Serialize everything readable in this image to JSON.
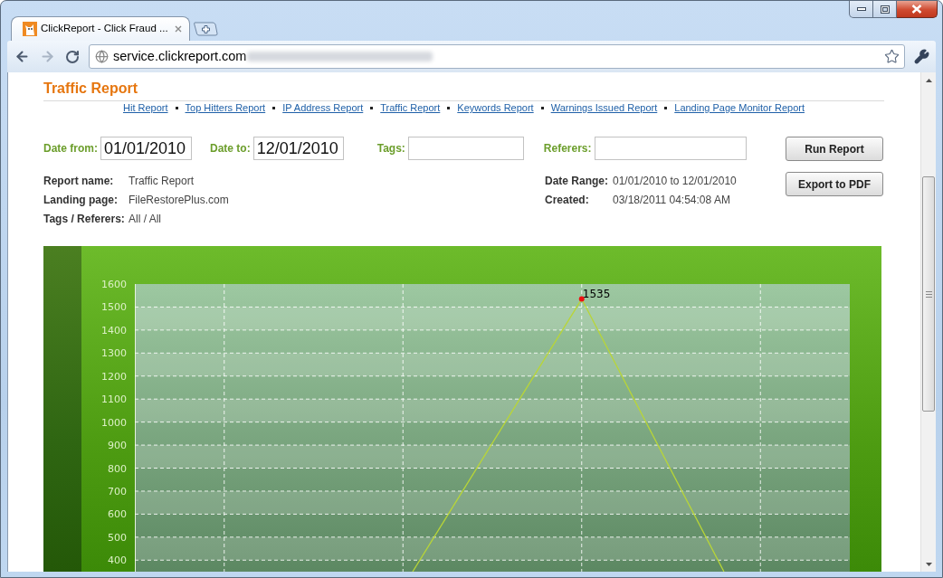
{
  "window": {
    "tab": {
      "title": "ClickReport - Click Fraud ..."
    },
    "address_bar": {
      "value": "service.clickreport.com"
    }
  },
  "page": {
    "title": "Traffic Report",
    "report_links": [
      "Hit Report",
      "Top Hitters Report",
      "IP Address Report",
      "Traffic Report",
      "Keywords Report",
      "Warnings Issued Report",
      "Landing Page Monitor Report"
    ],
    "filters": [
      {
        "kind": "date",
        "label": "Date from:",
        "value": "01/01/2010"
      },
      {
        "kind": "date",
        "label": "Date to:",
        "value": "12/01/2010"
      },
      {
        "kind": "text",
        "label": "Tags:"
      },
      {
        "kind": "text",
        "label": "Referers:"
      }
    ],
    "buttons": [
      "Run Report",
      "Export to PDF"
    ],
    "details_left": [
      {
        "label": "Report name:",
        "value": "Traffic Report"
      },
      {
        "label": "Landing page:",
        "value": "FileRestorePlus.com"
      },
      {
        "label": "Tags / Referers:",
        "value": "All / All"
      }
    ],
    "details_right": [
      {
        "label": "Date Range:",
        "value": "01/01/2010 to 12/01/2010"
      },
      {
        "label": "Created:",
        "value": "03/18/2011 04:54:08 AM"
      }
    ],
    "chart": {
      "chart_data": {
        "type": "line",
        "categories": [
          null,
          null,
          null,
          null
        ],
        "ylim": [
          350,
          1600
        ],
        "yticks": [
          400,
          500,
          600,
          700,
          800,
          900,
          1000,
          1100,
          1200,
          1300,
          1400,
          1500,
          1600
        ],
        "grid": true,
        "series": [
          {
            "color": "#ee1111",
            "marker": "circle",
            "values": [
              null,
              null,
              1535,
              null
            ]
          }
        ],
        "value_labels": [
          null,
          null,
          "1535",
          null
        ]
      }
    }
  }
}
